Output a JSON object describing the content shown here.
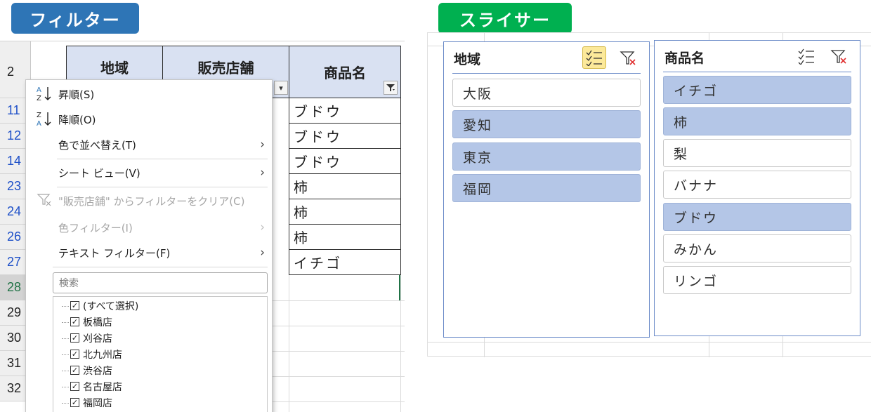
{
  "banners": {
    "filter": "フィルター",
    "slicer": "スライサー"
  },
  "sheet": {
    "header_row_number": "2",
    "row_numbers": [
      "11",
      "12",
      "14",
      "23",
      "24",
      "26",
      "27",
      "28",
      "29",
      "30",
      "31",
      "32"
    ],
    "columns": {
      "region": "地域",
      "store": "販売店舗",
      "product": "商品名"
    },
    "product_cells": [
      "ブドウ",
      "ブドウ",
      "ブドウ",
      "柿",
      "柿",
      "柿",
      "イチゴ"
    ]
  },
  "filter_menu": {
    "sort_asc": "昇順(S)",
    "sort_desc": "降順(O)",
    "sort_by_color": "色で並べ替え(T)",
    "sheet_view": "シート ビュー(V)",
    "clear_filter": "\"販売店舗\" からフィルターをクリア(C)",
    "color_filter": "色フィルター(I)",
    "text_filter": "テキスト フィルター(F)",
    "search_placeholder": "検索",
    "items": [
      {
        "label": "(すべて選択)",
        "checked": true
      },
      {
        "label": "板橋店",
        "checked": true
      },
      {
        "label": "刈谷店",
        "checked": true
      },
      {
        "label": "北九州店",
        "checked": true
      },
      {
        "label": "渋谷店",
        "checked": true
      },
      {
        "label": "名古屋店",
        "checked": true
      },
      {
        "label": "福岡店",
        "checked": true
      }
    ],
    "icons": [
      "sort-ascending-icon",
      "sort-descending-icon",
      "clear-filter-icon",
      "submenu-arrow-icon"
    ]
  },
  "slicers": [
    {
      "title": "地域",
      "multi_select_active": true,
      "items": [
        {
          "label": "大阪",
          "selected": false
        },
        {
          "label": "愛知",
          "selected": true
        },
        {
          "label": "東京",
          "selected": true
        },
        {
          "label": "福岡",
          "selected": true
        }
      ]
    },
    {
      "title": "商品名",
      "multi_select_active": false,
      "items": [
        {
          "label": "イチゴ",
          "selected": true
        },
        {
          "label": "柿",
          "selected": true
        },
        {
          "label": "梨",
          "selected": false
        },
        {
          "label": "バナナ",
          "selected": false
        },
        {
          "label": "ブドウ",
          "selected": true
        },
        {
          "label": "みかん",
          "selected": false
        },
        {
          "label": "リンゴ",
          "selected": false
        }
      ]
    }
  ],
  "colors": {
    "filter_banner": "#2e75b6",
    "slicer_banner": "#00b050",
    "header_fill": "#d9e1f2",
    "slicer_selected": "#b4c6e7",
    "multi_select_active": "#fce99a",
    "row_number_filtered": "#1e50c8",
    "active_row": "#217346"
  }
}
